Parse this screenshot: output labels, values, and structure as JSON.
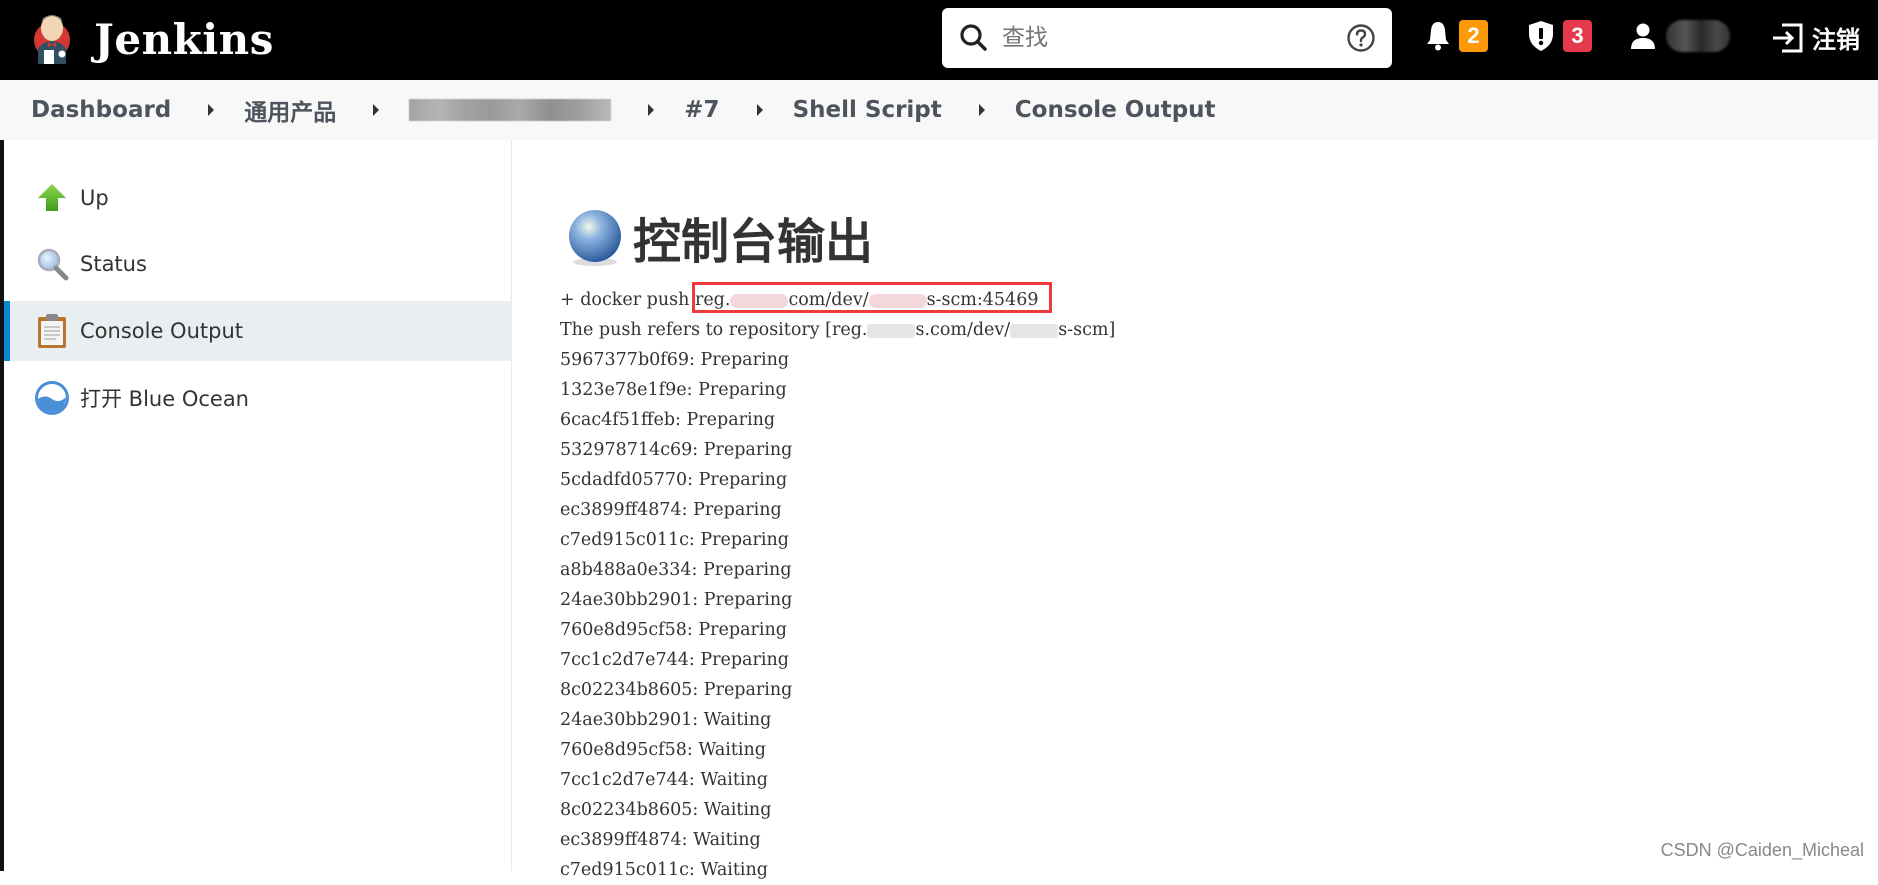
{
  "header": {
    "brand": "Jenkins",
    "search_placeholder": "查找",
    "notifications_count": "2",
    "security_count": "3",
    "logout_label": "注销",
    "colors": {
      "notifications_badge": "#fe9a09",
      "security_badge": "#e43a4b",
      "header_bg": "#000000"
    }
  },
  "breadcrumb": {
    "items": [
      "Dashboard",
      "通用产品",
      "",
      "#7",
      "Shell Script",
      "Console Output"
    ]
  },
  "sidebar": {
    "items": [
      {
        "label": "Up",
        "icon": "up-arrow-icon"
      },
      {
        "label": "Status",
        "icon": "magnifier-icon"
      },
      {
        "label": "Console Output",
        "icon": "clipboard-icon",
        "active": true
      },
      {
        "label": "打开 Blue Ocean",
        "icon": "blue-ocean-icon"
      }
    ]
  },
  "main": {
    "title": "控制台输出",
    "console": {
      "push_cmd_prefix": "+ docker push ",
      "push_cmd_target_a": "reg.",
      "push_cmd_target_b": "com/dev/",
      "push_cmd_target_c": "s-scm:45469",
      "refers_prefix": "The push refers to repository [reg.",
      "refers_mid": "s.com/dev/",
      "refers_end": "s-scm]",
      "lines": [
        "5967377b0f69: Preparing",
        "1323e78e1f9e: Preparing",
        "6cac4f51ffeb: Preparing",
        "532978714c69: Preparing",
        "5cdadfd05770: Preparing",
        "ec3899ff4874: Preparing",
        "c7ed915c011c: Preparing",
        "a8b488a0e334: Preparing",
        "24ae30bb2901: Preparing",
        "760e8d95cf58: Preparing",
        "7cc1c2d7e744: Preparing",
        "8c02234b8605: Preparing",
        "24ae30bb2901: Waiting",
        "760e8d95cf58: Waiting",
        "7cc1c2d7e744: Waiting",
        "8c02234b8605: Waiting",
        "ec3899ff4874: Waiting",
        "c7ed915c011c: Waiting"
      ]
    }
  },
  "watermark": "CSDN @Caiden_Micheal"
}
